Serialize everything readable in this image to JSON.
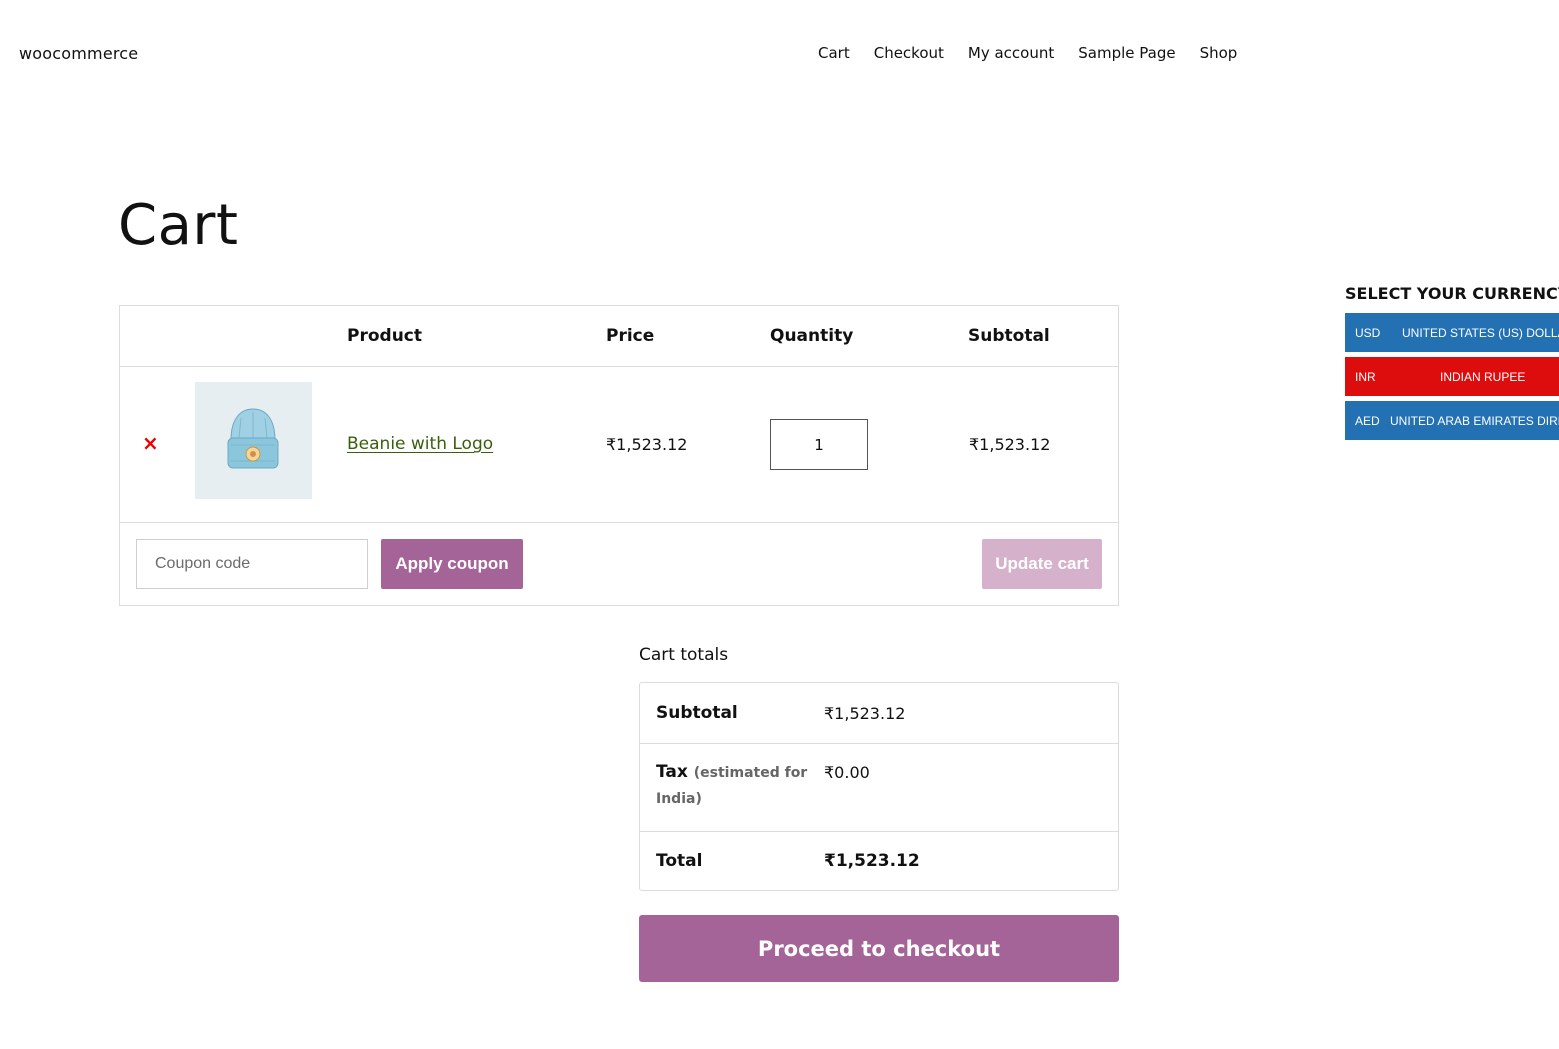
{
  "site": {
    "title": "woocommerce"
  },
  "nav": [
    "Cart",
    "Checkout",
    "My account",
    "Sample Page",
    "Shop"
  ],
  "page": {
    "title": "Cart"
  },
  "cart_table": {
    "headers": {
      "product": "Product",
      "price": "Price",
      "quantity": "Quantity",
      "subtotal": "Subtotal"
    },
    "items": [
      {
        "remove_icon": "×",
        "name": "Beanie with Logo",
        "price": "₹1,523.12",
        "quantity": "1",
        "subtotal": "₹1,523.12",
        "thumbnail": "beanie-image"
      }
    ],
    "coupon": {
      "placeholder": "Coupon code",
      "apply_label": "Apply coupon"
    },
    "update_label": "Update cart"
  },
  "totals": {
    "heading": "Cart totals",
    "subtotal_label": "Subtotal",
    "subtotal_value": "₹1,523.12",
    "tax_label": "Tax",
    "tax_note_1": "(estimated for",
    "tax_note_2": "India)",
    "tax_value": "₹0.00",
    "total_label": "Total",
    "total_value": "₹1,523.12",
    "checkout_label": "Proceed to checkout"
  },
  "currency_switcher": {
    "title": "SELECT YOUR CURRENCY",
    "items": [
      {
        "code": "USD",
        "name": "UNITED STATES (US) DOLLAR",
        "color": "#2371b3"
      },
      {
        "code": "INR",
        "name": "INDIAN RUPEE",
        "color": "#dd0d0d"
      },
      {
        "code": "AED",
        "name": "UNITED ARAB EMIRATES DIRHAM",
        "color": "#2371b3"
      }
    ]
  },
  "colors": {
    "primary_button": "#a46497",
    "disabled_button": "#d6b1cb",
    "link": "#3a5f0b",
    "remove": "#e00000"
  }
}
